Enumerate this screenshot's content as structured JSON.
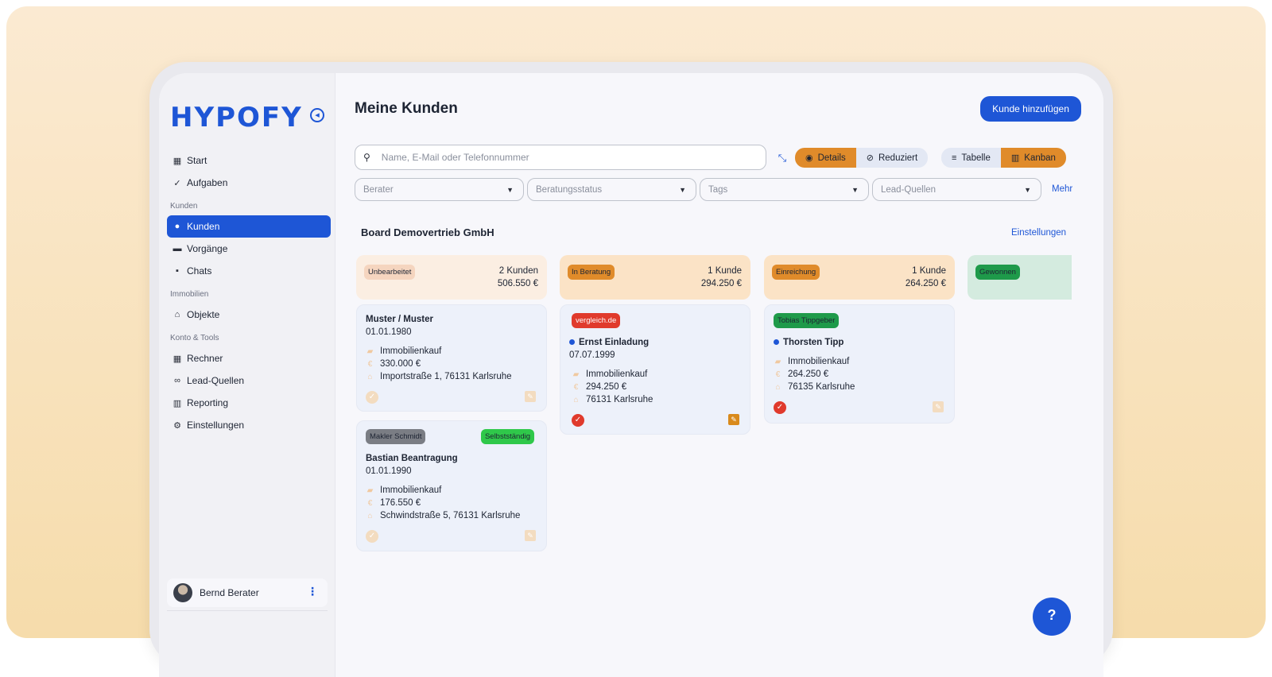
{
  "app": {
    "logo": "HYPOFY"
  },
  "sidebar": {
    "items_main": [
      {
        "label": "Start",
        "icon": "dashboard-icon"
      },
      {
        "label": "Aufgaben",
        "icon": "check-circle-icon"
      }
    ],
    "section_kunden": "Kunden",
    "items_kunden": [
      {
        "label": "Kunden",
        "icon": "people-icon",
        "active": true
      },
      {
        "label": "Vorgänge",
        "icon": "folder-icon"
      },
      {
        "label": "Chats",
        "icon": "chat-icon"
      }
    ],
    "section_immobilien": "Immobilien",
    "items_immobilien": [
      {
        "label": "Objekte",
        "icon": "home-icon"
      }
    ],
    "section_tools": "Konto & Tools",
    "items_tools": [
      {
        "label": "Rechner",
        "icon": "calculator-icon"
      },
      {
        "label": "Lead-Quellen",
        "icon": "link-icon"
      },
      {
        "label": "Reporting",
        "icon": "chart-icon"
      },
      {
        "label": "Einstellungen",
        "icon": "gear-icon"
      }
    ],
    "user": {
      "name": "Bernd Berater"
    }
  },
  "header": {
    "title": "Meine Kunden",
    "add_button": "Kunde hinzufügen"
  },
  "search": {
    "placeholder": "Name, E-Mail oder Telefonnummer",
    "value": ""
  },
  "view_toggle": {
    "detail_options": [
      {
        "label": "Details",
        "selected": true
      },
      {
        "label": "Reduziert",
        "selected": false
      }
    ],
    "layout_options": [
      {
        "label": "Tabelle",
        "selected": false
      },
      {
        "label": "Kanban",
        "selected": true
      }
    ]
  },
  "filters": [
    {
      "placeholder": "Berater"
    },
    {
      "placeholder": "Beratungsstatus"
    },
    {
      "placeholder": "Tags"
    },
    {
      "placeholder": "Lead-Quellen"
    }
  ],
  "filters_more": "Mehr",
  "board": {
    "title": "Board Demovertrieb GmbH",
    "settings_link": "Einstellungen",
    "columns": [
      {
        "status": "Unbearbeitet",
        "count": "2 Kunden",
        "sum": "506.550 €",
        "head_color": "#fbeee2",
        "badge_color": "#f5d5bf",
        "cards": [
          {
            "name": "Muster / Muster",
            "date": "01.01.1980",
            "purpose": "Immobilienkauf",
            "amount": "330.000 €",
            "address": "Importstraße 1, 76131 Karlsruhe"
          },
          {
            "tag_left": "Makler Schmidt",
            "tag_right": "Selbstständig",
            "name": "Bastian Beantragung",
            "date": "01.01.1990",
            "purpose": "Immobilienkauf",
            "amount": "176.550 €",
            "address": "Schwindstraße 5, 76131 Karlsruhe"
          }
        ]
      },
      {
        "status": "In Beratung",
        "count": "1 Kunde",
        "sum": "294.250 €",
        "head_color": "#fbe3c6",
        "badge_color": "#e08b2a",
        "cards": [
          {
            "tag": "vergleich.de",
            "name": "Ernst Einladung",
            "date": "07.07.1999",
            "purpose": "Immobilienkauf",
            "amount": "294.250 €",
            "address": "76131 Karlsruhe"
          }
        ]
      },
      {
        "status": "Einreichung",
        "count": "1 Kunde",
        "sum": "264.250 €",
        "head_color": "#fbe3c6",
        "badge_color": "#e08b2a",
        "cards": [
          {
            "tag": "Tobias Tippgeber",
            "name": "Thorsten Tipp",
            "purpose": "Immobilienkauf",
            "amount": "264.250 €",
            "address": "76135 Karlsruhe"
          }
        ]
      },
      {
        "status": "Gewonnen",
        "head_color": "#d4ebdf",
        "badge_color": "#1e9a4a"
      }
    ]
  },
  "help_button": "?"
}
